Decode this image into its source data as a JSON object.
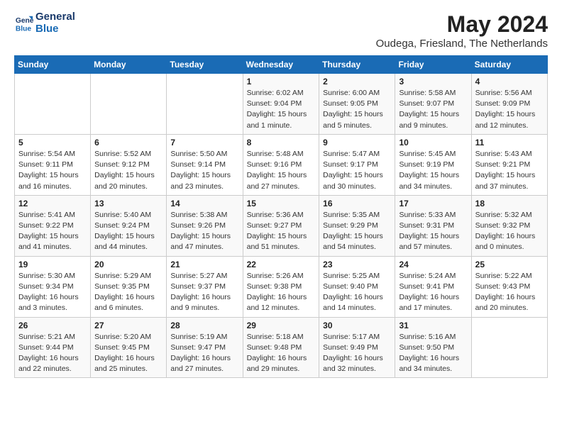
{
  "header": {
    "logo_line1": "General",
    "logo_line2": "Blue",
    "title": "May 2024",
    "subtitle": "Oudega, Friesland, The Netherlands"
  },
  "days_of_week": [
    "Sunday",
    "Monday",
    "Tuesday",
    "Wednesday",
    "Thursday",
    "Friday",
    "Saturday"
  ],
  "weeks": [
    [
      {
        "day": "",
        "detail": ""
      },
      {
        "day": "",
        "detail": ""
      },
      {
        "day": "",
        "detail": ""
      },
      {
        "day": "1",
        "detail": "Sunrise: 6:02 AM\nSunset: 9:04 PM\nDaylight: 15 hours\nand 1 minute."
      },
      {
        "day": "2",
        "detail": "Sunrise: 6:00 AM\nSunset: 9:05 PM\nDaylight: 15 hours\nand 5 minutes."
      },
      {
        "day": "3",
        "detail": "Sunrise: 5:58 AM\nSunset: 9:07 PM\nDaylight: 15 hours\nand 9 minutes."
      },
      {
        "day": "4",
        "detail": "Sunrise: 5:56 AM\nSunset: 9:09 PM\nDaylight: 15 hours\nand 12 minutes."
      }
    ],
    [
      {
        "day": "5",
        "detail": "Sunrise: 5:54 AM\nSunset: 9:11 PM\nDaylight: 15 hours\nand 16 minutes."
      },
      {
        "day": "6",
        "detail": "Sunrise: 5:52 AM\nSunset: 9:12 PM\nDaylight: 15 hours\nand 20 minutes."
      },
      {
        "day": "7",
        "detail": "Sunrise: 5:50 AM\nSunset: 9:14 PM\nDaylight: 15 hours\nand 23 minutes."
      },
      {
        "day": "8",
        "detail": "Sunrise: 5:48 AM\nSunset: 9:16 PM\nDaylight: 15 hours\nand 27 minutes."
      },
      {
        "day": "9",
        "detail": "Sunrise: 5:47 AM\nSunset: 9:17 PM\nDaylight: 15 hours\nand 30 minutes."
      },
      {
        "day": "10",
        "detail": "Sunrise: 5:45 AM\nSunset: 9:19 PM\nDaylight: 15 hours\nand 34 minutes."
      },
      {
        "day": "11",
        "detail": "Sunrise: 5:43 AM\nSunset: 9:21 PM\nDaylight: 15 hours\nand 37 minutes."
      }
    ],
    [
      {
        "day": "12",
        "detail": "Sunrise: 5:41 AM\nSunset: 9:22 PM\nDaylight: 15 hours\nand 41 minutes."
      },
      {
        "day": "13",
        "detail": "Sunrise: 5:40 AM\nSunset: 9:24 PM\nDaylight: 15 hours\nand 44 minutes."
      },
      {
        "day": "14",
        "detail": "Sunrise: 5:38 AM\nSunset: 9:26 PM\nDaylight: 15 hours\nand 47 minutes."
      },
      {
        "day": "15",
        "detail": "Sunrise: 5:36 AM\nSunset: 9:27 PM\nDaylight: 15 hours\nand 51 minutes."
      },
      {
        "day": "16",
        "detail": "Sunrise: 5:35 AM\nSunset: 9:29 PM\nDaylight: 15 hours\nand 54 minutes."
      },
      {
        "day": "17",
        "detail": "Sunrise: 5:33 AM\nSunset: 9:31 PM\nDaylight: 15 hours\nand 57 minutes."
      },
      {
        "day": "18",
        "detail": "Sunrise: 5:32 AM\nSunset: 9:32 PM\nDaylight: 16 hours\nand 0 minutes."
      }
    ],
    [
      {
        "day": "19",
        "detail": "Sunrise: 5:30 AM\nSunset: 9:34 PM\nDaylight: 16 hours\nand 3 minutes."
      },
      {
        "day": "20",
        "detail": "Sunrise: 5:29 AM\nSunset: 9:35 PM\nDaylight: 16 hours\nand 6 minutes."
      },
      {
        "day": "21",
        "detail": "Sunrise: 5:27 AM\nSunset: 9:37 PM\nDaylight: 16 hours\nand 9 minutes."
      },
      {
        "day": "22",
        "detail": "Sunrise: 5:26 AM\nSunset: 9:38 PM\nDaylight: 16 hours\nand 12 minutes."
      },
      {
        "day": "23",
        "detail": "Sunrise: 5:25 AM\nSunset: 9:40 PM\nDaylight: 16 hours\nand 14 minutes."
      },
      {
        "day": "24",
        "detail": "Sunrise: 5:24 AM\nSunset: 9:41 PM\nDaylight: 16 hours\nand 17 minutes."
      },
      {
        "day": "25",
        "detail": "Sunrise: 5:22 AM\nSunset: 9:43 PM\nDaylight: 16 hours\nand 20 minutes."
      }
    ],
    [
      {
        "day": "26",
        "detail": "Sunrise: 5:21 AM\nSunset: 9:44 PM\nDaylight: 16 hours\nand 22 minutes."
      },
      {
        "day": "27",
        "detail": "Sunrise: 5:20 AM\nSunset: 9:45 PM\nDaylight: 16 hours\nand 25 minutes."
      },
      {
        "day": "28",
        "detail": "Sunrise: 5:19 AM\nSunset: 9:47 PM\nDaylight: 16 hours\nand 27 minutes."
      },
      {
        "day": "29",
        "detail": "Sunrise: 5:18 AM\nSunset: 9:48 PM\nDaylight: 16 hours\nand 29 minutes."
      },
      {
        "day": "30",
        "detail": "Sunrise: 5:17 AM\nSunset: 9:49 PM\nDaylight: 16 hours\nand 32 minutes."
      },
      {
        "day": "31",
        "detail": "Sunrise: 5:16 AM\nSunset: 9:50 PM\nDaylight: 16 hours\nand 34 minutes."
      },
      {
        "day": "",
        "detail": ""
      }
    ]
  ]
}
